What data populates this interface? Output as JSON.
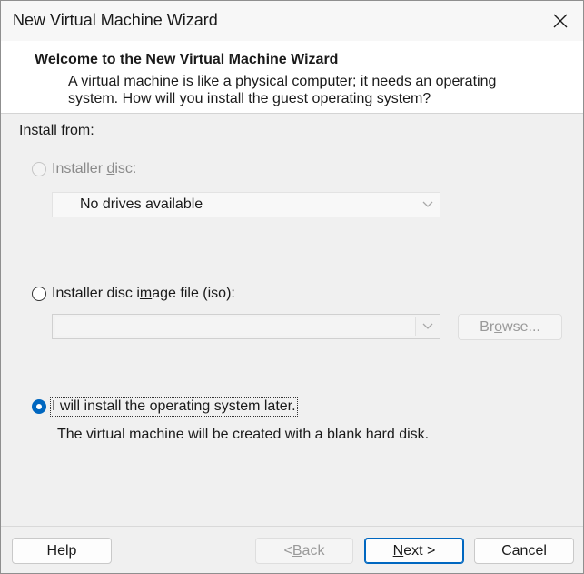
{
  "window": {
    "title": "New Virtual Machine Wizard",
    "close_icon": "close-icon"
  },
  "header": {
    "heading": "Welcome to the New Virtual Machine Wizard",
    "description": "A virtual machine is like a physical computer; it needs an operating system. How will you install the guest operating system?"
  },
  "install_from_label": "Install from:",
  "options": {
    "installer_disc": {
      "label_pre": "Installer ",
      "label_access": "d",
      "label_post": "isc:",
      "selected": false,
      "enabled": false,
      "dropdown_value": "No drives available"
    },
    "iso_file": {
      "label_pre": "Installer disc i",
      "label_access": "m",
      "label_post": "age file (iso):",
      "selected": false,
      "enabled": true,
      "path_value": "",
      "browse_pre": "Br",
      "browse_access": "o",
      "browse_post": "wse..."
    },
    "install_later": {
      "label": "I will install the operating system later.",
      "selected": true,
      "enabled": true,
      "description": "The virtual machine will be created with a blank hard disk."
    }
  },
  "footer": {
    "help_label": "Help",
    "back_pre": "< ",
    "back_access": "B",
    "back_post": "ack",
    "next_access": "N",
    "next_post": "ext >",
    "cancel_label": "Cancel"
  },
  "colors": {
    "accent": "#0067c0",
    "dialog_bg": "#f0f0f0"
  }
}
